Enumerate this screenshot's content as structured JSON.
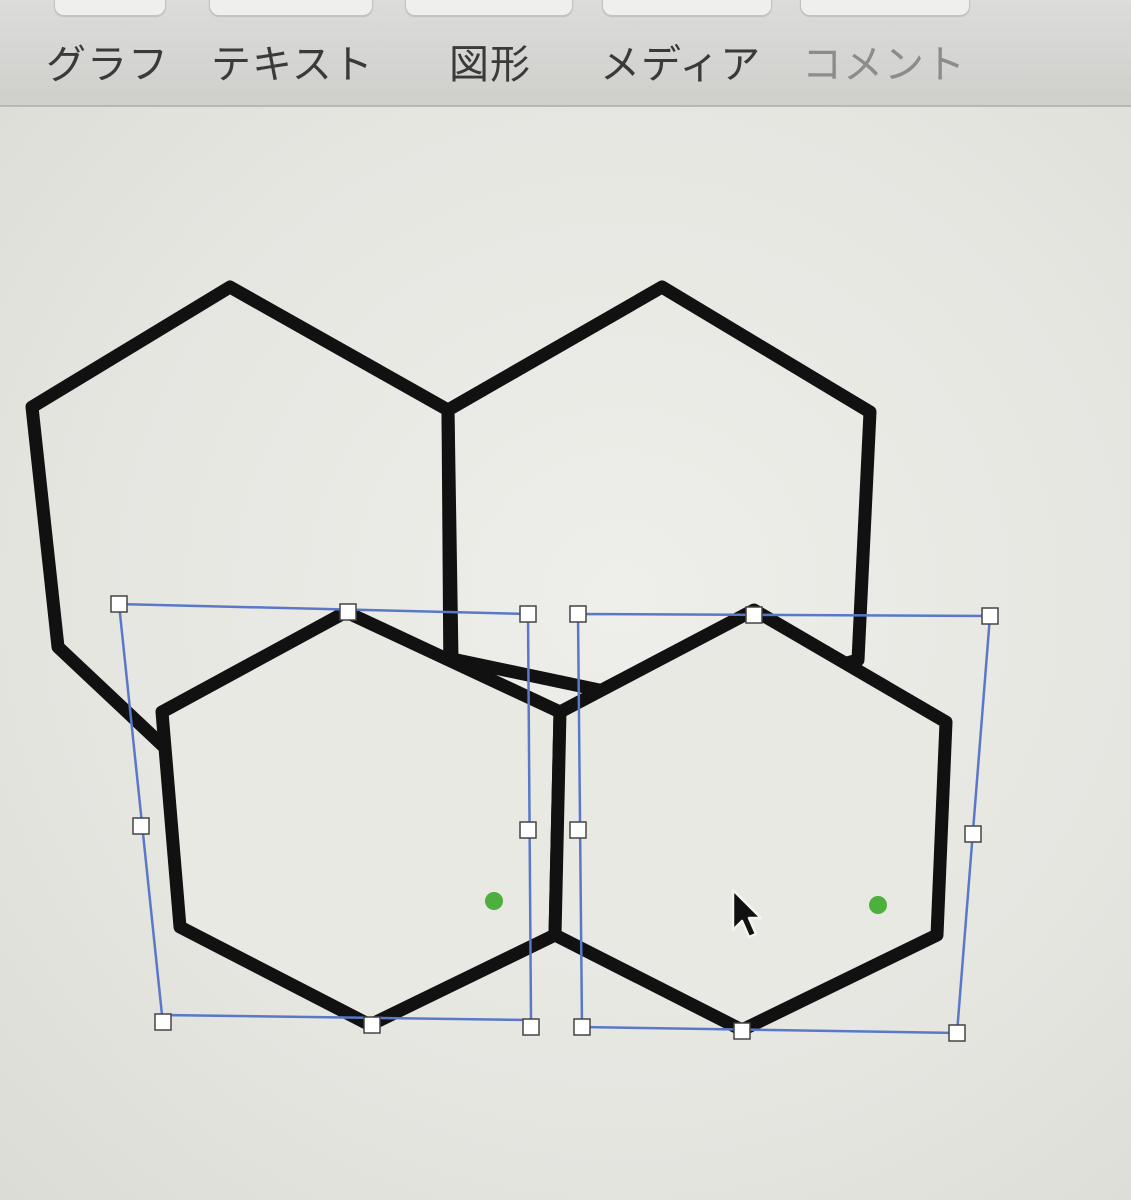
{
  "toolbar": {
    "items": [
      {
        "label": "グラフ",
        "enabled": true
      },
      {
        "label": "テキスト",
        "enabled": true
      },
      {
        "label": "図形",
        "enabled": true
      },
      {
        "label": "メディア",
        "enabled": true
      },
      {
        "label": "コメント",
        "enabled": false
      }
    ]
  },
  "canvas": {
    "shape": "hexagon",
    "selected_count": 2,
    "colors": {
      "stroke": "#111111",
      "selection": "#5a78c8",
      "handle_fill": "#ffffff",
      "handle_stroke": "#444444",
      "edit_point": "#4caf3e"
    }
  },
  "icons": {
    "pointer": "mouse-pointer-icon"
  }
}
